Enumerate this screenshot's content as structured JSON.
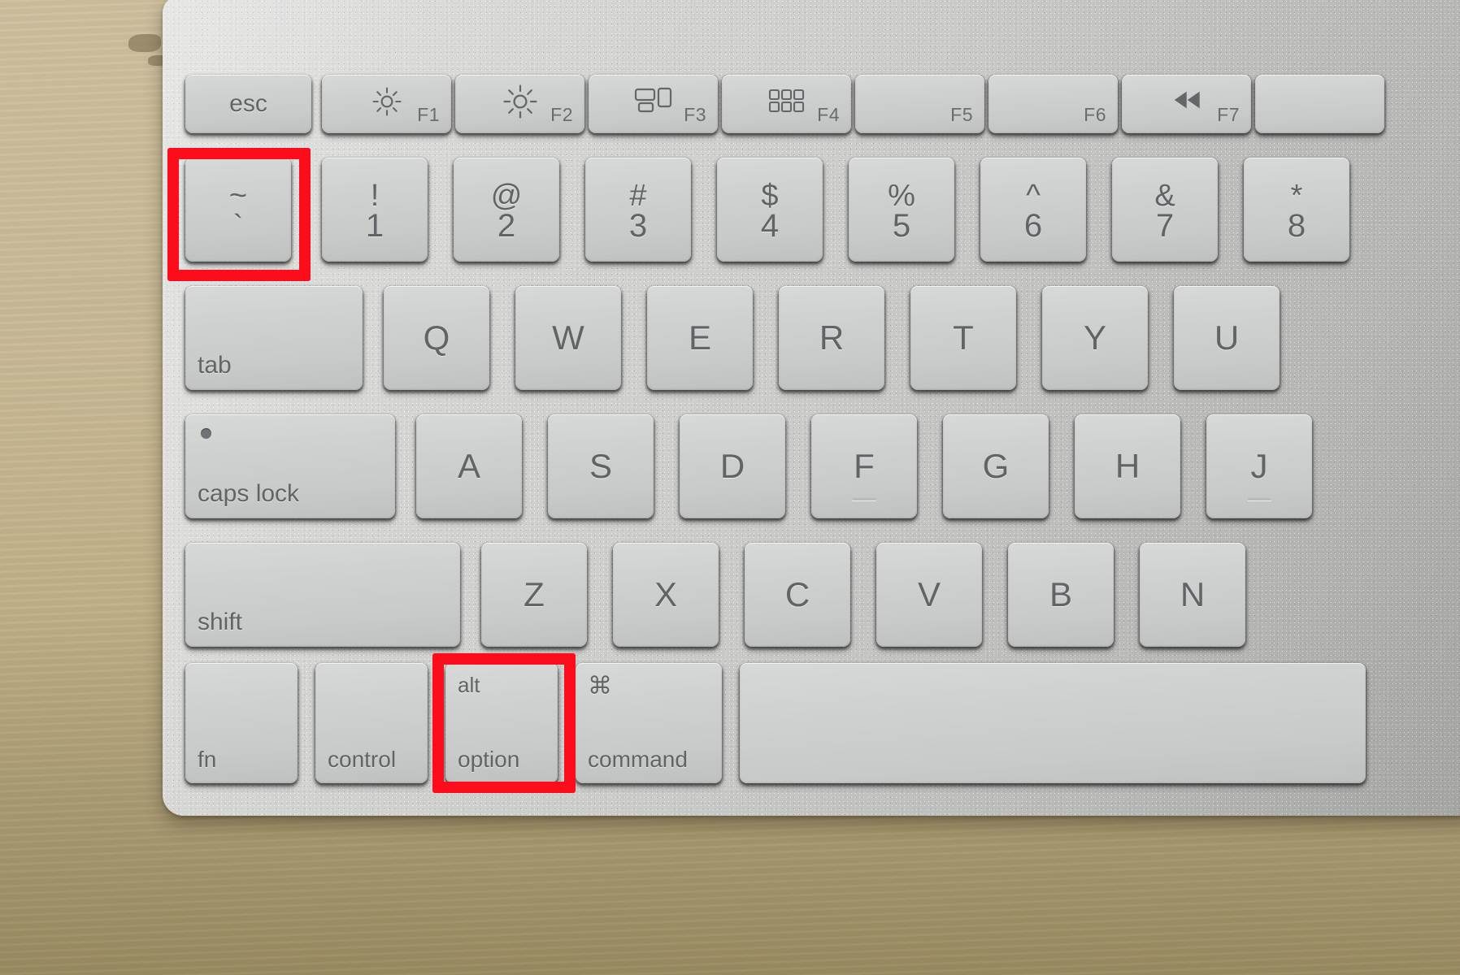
{
  "scene": {
    "subject": "Apple Magic Keyboard on a wooden desk",
    "desk_color": "#c7b895",
    "keyboard_body_color": "#d0d0ce",
    "key_color": "#cfd1d0",
    "key_text_color": "#616466",
    "highlight_color": "#fc0d1b"
  },
  "highlights": [
    {
      "name": "tilde-key-highlight",
      "target": "tilde-key"
    },
    {
      "name": "option-key-highlight",
      "target": "alt-option-key"
    }
  ],
  "keyboard": {
    "rows": [
      {
        "name": "function-row",
        "keys": [
          {
            "id": "esc",
            "main": "esc",
            "fn": "",
            "icon": ""
          },
          {
            "id": "f1",
            "main": "",
            "fn": "F1",
            "icon": "brightness-low-icon"
          },
          {
            "id": "f2",
            "main": "",
            "fn": "F2",
            "icon": "brightness-high-icon"
          },
          {
            "id": "f3",
            "main": "",
            "fn": "F3",
            "icon": "mission-control-icon"
          },
          {
            "id": "f4",
            "main": "",
            "fn": "F4",
            "icon": "launchpad-icon"
          },
          {
            "id": "f5",
            "main": "",
            "fn": "F5",
            "icon": ""
          },
          {
            "id": "f6",
            "main": "",
            "fn": "F6",
            "icon": ""
          },
          {
            "id": "f7",
            "main": "",
            "fn": "F7",
            "icon": "rewind-icon"
          },
          {
            "id": "f8",
            "main": "",
            "fn": "",
            "icon": ""
          }
        ]
      },
      {
        "name": "number-row",
        "keys": [
          {
            "id": "tilde",
            "top": "~",
            "bottom": "`"
          },
          {
            "id": "one",
            "top": "!",
            "bottom": "1"
          },
          {
            "id": "two",
            "top": "@",
            "bottom": "2"
          },
          {
            "id": "three",
            "top": "#",
            "bottom": "3"
          },
          {
            "id": "four",
            "top": "$",
            "bottom": "4"
          },
          {
            "id": "five",
            "top": "%",
            "bottom": "5"
          },
          {
            "id": "six",
            "top": "^",
            "bottom": "6"
          },
          {
            "id": "seven",
            "top": "&",
            "bottom": "7"
          },
          {
            "id": "eight",
            "top": "*",
            "bottom": "8"
          }
        ]
      },
      {
        "name": "qwerty-row",
        "keys": [
          {
            "id": "tab",
            "label": "tab"
          },
          {
            "id": "q",
            "label": "Q"
          },
          {
            "id": "w",
            "label": "W"
          },
          {
            "id": "e",
            "label": "E"
          },
          {
            "id": "r",
            "label": "R"
          },
          {
            "id": "t",
            "label": "T"
          },
          {
            "id": "y",
            "label": "Y"
          },
          {
            "id": "u",
            "label": "U"
          }
        ]
      },
      {
        "name": "home-row",
        "keys": [
          {
            "id": "capslock",
            "label": "caps lock"
          },
          {
            "id": "a",
            "label": "A"
          },
          {
            "id": "s",
            "label": "S"
          },
          {
            "id": "d",
            "label": "D"
          },
          {
            "id": "f",
            "label": "F"
          },
          {
            "id": "g",
            "label": "G"
          },
          {
            "id": "h",
            "label": "H"
          },
          {
            "id": "j",
            "label": "J"
          }
        ]
      },
      {
        "name": "shift-row",
        "keys": [
          {
            "id": "shift",
            "label": "shift"
          },
          {
            "id": "z",
            "label": "Z"
          },
          {
            "id": "x",
            "label": "X"
          },
          {
            "id": "c",
            "label": "C"
          },
          {
            "id": "v",
            "label": "V"
          },
          {
            "id": "b",
            "label": "B"
          },
          {
            "id": "n",
            "label": "N"
          }
        ]
      },
      {
        "name": "modifier-row",
        "keys": [
          {
            "id": "fn",
            "label": "fn"
          },
          {
            "id": "control",
            "label": "control"
          },
          {
            "id": "option",
            "top": "alt",
            "label": "option"
          },
          {
            "id": "command",
            "top": "⌘",
            "label": "command"
          },
          {
            "id": "space",
            "label": ""
          }
        ]
      }
    ]
  }
}
